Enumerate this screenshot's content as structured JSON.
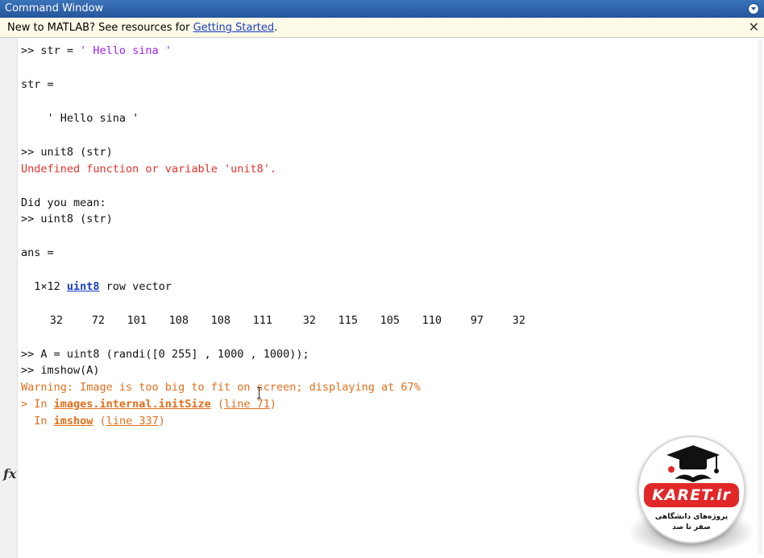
{
  "window": {
    "title": "Command Window",
    "menu_icon": "chevron-down-circle-icon"
  },
  "infobar": {
    "prefix": "New to MATLAB? See resources for ",
    "link": "Getting Started",
    "suffix": ".",
    "close": "✕"
  },
  "console": {
    "l1_prompt": ">> str = ",
    "l1_str": "' Hello sina '",
    "l2": "str =",
    "l3": "    ' Hello sina '",
    "l4": ">> unit8 (str)",
    "l5_error": "Undefined function or variable 'unit8'.",
    "l6": "Did you mean:",
    "l7": ">> uint8 (str)",
    "l8": "ans =",
    "l9_pre": "  1×12 ",
    "l9_link": "uint8",
    "l9_post": " row vector",
    "values": [
      "32",
      "72",
      "101",
      "108",
      "108",
      "111",
      "32",
      "115",
      "105",
      "110",
      "97",
      "32"
    ],
    "l11": ">> A = uint8 (randi([0 255] , 1000 , 1000));",
    "l12": ">> imshow(A)",
    "l13_warning": "Warning: Image is too big to fit on screen; displaying at 67%",
    "l14_pre": "> In ",
    "l14_link": "images.internal.initSize",
    "l14_paren_open": " (",
    "l14_line": "line 71",
    "l14_paren_close": ")",
    "l15_pre": "  In ",
    "l15_link": "imshow",
    "l15_paren_open": " (",
    "l15_line": "line 337",
    "l15_paren_close": ")"
  },
  "gutter": {
    "fx": "fx"
  },
  "logo": {
    "badge": "KARET.ir",
    "line1": "پروژه‌های دانشگاهی",
    "line2": "صفر تا صد",
    "icon": "graduation-cap-mustache-icon",
    "accent": "#e12727"
  }
}
